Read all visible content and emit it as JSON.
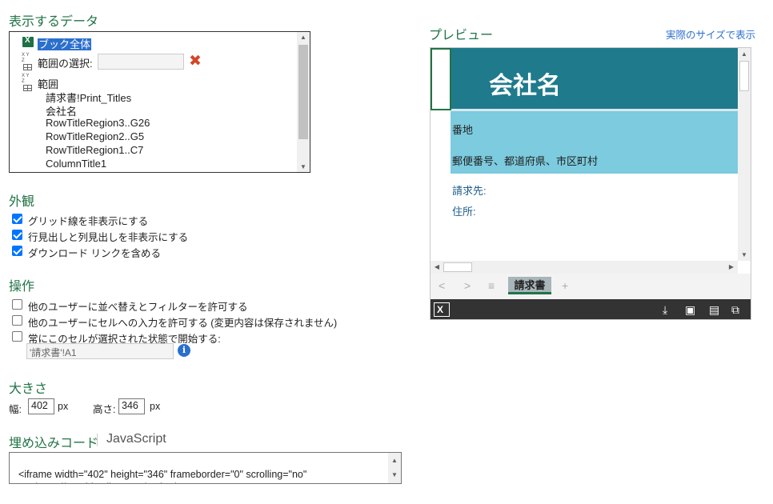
{
  "display_data": {
    "title": "表示するデータ",
    "items": {
      "workbook": "ブック全体",
      "select_range": "範囲の選択:",
      "range": "範囲",
      "ranges": [
        "請求書!Print_Titles",
        "会社名",
        "RowTitleRegion3..G26",
        "RowTitleRegion2..G5",
        "RowTitleRegion1..C7",
        "ColumnTitle1"
      ]
    }
  },
  "appearance": {
    "title": "外観",
    "options": [
      {
        "label": "グリッド線を非表示にする",
        "checked": true
      },
      {
        "label": "行見出しと列見出しを非表示にする",
        "checked": true
      },
      {
        "label": "ダウンロード リンクを含める",
        "checked": true
      }
    ]
  },
  "interaction": {
    "title": "操作",
    "options": [
      {
        "label": "他のユーザーに並べ替えとフィルターを許可する",
        "checked": false
      },
      {
        "label": "他のユーザーにセルへの入力を許可する (変更内容は保存されません)",
        "checked": false
      },
      {
        "label": "常にこのセルが選択された状態で開始する:",
        "checked": false
      }
    ],
    "start_cell": "'請求書'!A1"
  },
  "size": {
    "title": "大きさ",
    "width_label": "幅:",
    "width": "402",
    "height_label": "高さ:",
    "height": "346",
    "unit": "px"
  },
  "embed": {
    "title": "埋め込みコード",
    "alt_tab": "JavaScript",
    "code": "<iframe width=\"402\" height=\"346\" frameborder=\"0\" scrolling=\"no\"\nsrc=\"https://onedrive.live.com/embed?"
  },
  "preview": {
    "title": "プレビュー",
    "actual_size_link": "実際のサイズで表示",
    "company_name": "会社名",
    "address": "番地",
    "postal": "郵便番号、都道府県、市区町村",
    "bill_to": "請求先:",
    "residence": "住所:",
    "sheet_tab": "請求書"
  },
  "icons": [
    "excel-icon",
    "range-icon",
    "clear-icon",
    "info-icon",
    "download-icon",
    "save-icon",
    "fullscreen-icon",
    "popout-icon"
  ],
  "colors": {
    "accent": "#217346",
    "header": "#1f7a8c",
    "band": "#7ccbde",
    "link": "#2b6fce"
  }
}
